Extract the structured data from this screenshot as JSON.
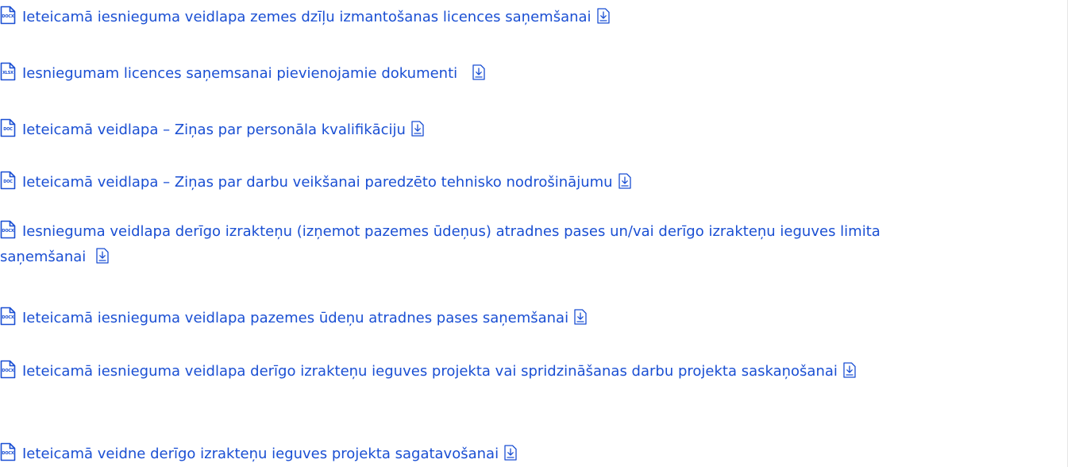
{
  "colors": {
    "link": "#1a4fd3",
    "divider": "#e6e6e6"
  },
  "icons": {
    "file": "file-icon",
    "download": "download-icon"
  },
  "documents": [
    {
      "ext": "DOCX",
      "title": "Ieteicamā iesnieguma veidlapa zemes dzīļu izmantošanas licences saņemšanai"
    },
    {
      "ext": "XLSX",
      "title": "Iesniegumam licences saņemsanai pievienojamie dokumenti"
    },
    {
      "ext": "DOC",
      "title": "Ieteicamā veidlapa – Ziņas par personāla kvalifikāciju"
    },
    {
      "ext": "DOC",
      "title": "Ieteicamā veidlapa – Ziņas par darbu veikšanai paredzēto tehnisko nodrošinājumu"
    },
    {
      "ext": "DOCX",
      "title": "Iesnieguma veidlapa derīgo izrakteņu (izņemot pazemes ūdeņus) atradnes pases un/vai derīgo izrakteņu ieguves limita",
      "title2": "saņemšanai"
    },
    {
      "ext": "DOCX",
      "title": "Ieteicamā iesnieguma veidlapa pazemes ūdeņu atradnes pases saņemšanai"
    },
    {
      "ext": "DOCX",
      "title": "Ieteicamā iesnieguma veidlapa derīgo izrakteņu ieguves projekta vai spridzināšanas darbu projekta saskaņošanai"
    },
    {
      "ext": "DOCX",
      "title": "Ieteicamā veidne derīgo izrakteņu ieguves projekta sagatavošanai"
    }
  ]
}
